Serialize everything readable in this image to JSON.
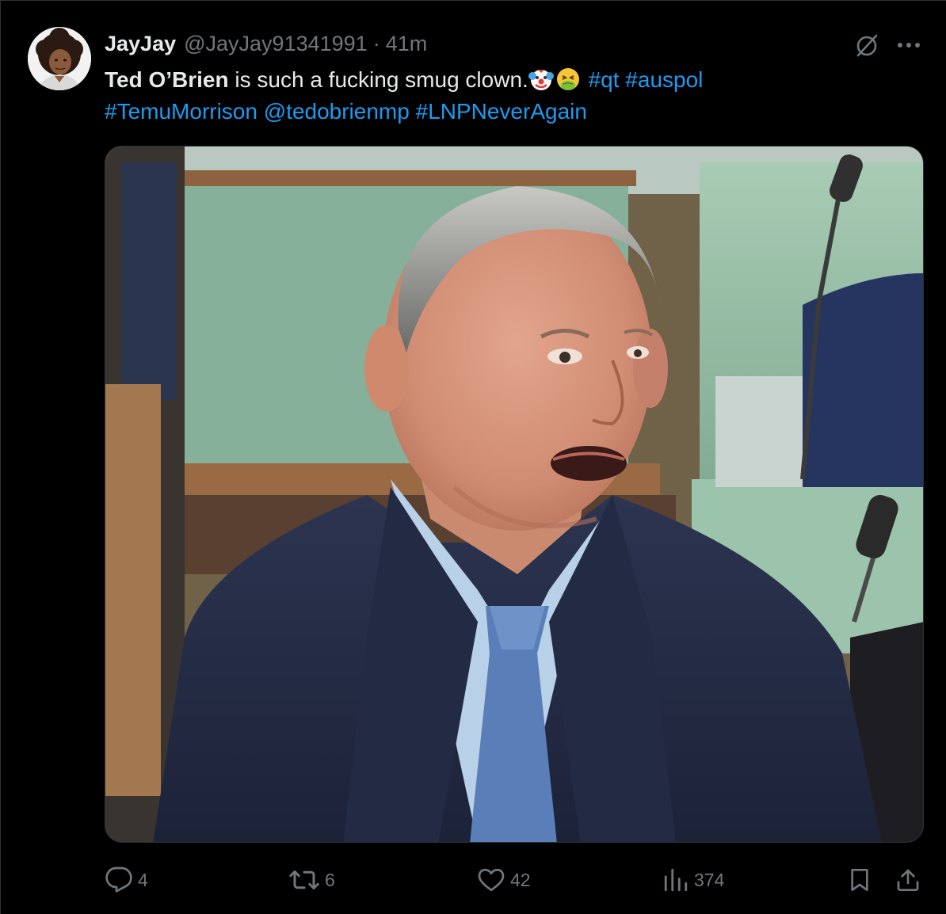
{
  "tweet": {
    "display_name": "JayJay",
    "handle": "@JayJay91341991",
    "separator": "·",
    "time": "41m",
    "text": {
      "mention_name": "Ted O’Brien",
      "sentence": " is such a fucking smug clown.",
      "emojis": [
        "clown-face-emoji",
        "nauseated-face-emoji"
      ],
      "hashtags_line1": [
        "#qt",
        "#auspol"
      ],
      "line2": [
        "#TemuMorrison",
        "@tedobrienmp",
        "#LNPNeverAgain"
      ]
    },
    "media_alt": "Photo of a man in a navy suit and blue patterned tie speaking in a parliamentary chamber with green leather benches"
  },
  "actions": {
    "replies": "4",
    "reposts": "6",
    "likes": "42",
    "views": "374"
  },
  "icons": {
    "grok": "grok-icon",
    "more": "more-icon",
    "reply": "reply-icon",
    "repost": "repost-icon",
    "like": "like-icon",
    "views": "views-icon",
    "bookmark": "bookmark-icon",
    "share": "share-icon"
  },
  "colors": {
    "background": "#000000",
    "text_primary": "#e7e9ea",
    "text_secondary": "#71767b",
    "link": "#1d9bf0",
    "border": "#2f3336"
  }
}
